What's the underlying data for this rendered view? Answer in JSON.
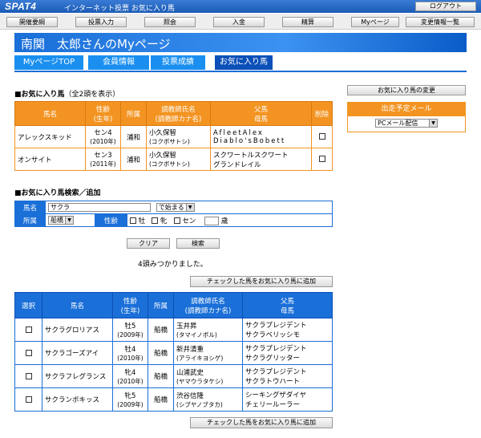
{
  "header": {
    "logo": "SPAT4",
    "subtitle": "インターネット投票 お気に入り馬",
    "logout": "ログアウト"
  },
  "nav": [
    "開催要綱",
    "投票入力",
    "照会",
    "入金",
    "精算",
    "Myページ",
    "変更情報一覧"
  ],
  "page_title": "南関　太郎さんのMyページ",
  "tabs": [
    "MyページTOP",
    "会員情報",
    "投票成績",
    "お気に入り馬"
  ],
  "favorites": {
    "heading": "■お気に入り馬",
    "count_note": "（全2頭を表示）",
    "headers": [
      "馬名",
      "性齢\n(生年)",
      "所属",
      "調教師氏名\n(調教師カナ名)",
      "父馬\n母馬",
      "削除"
    ],
    "rows": [
      {
        "name": "アレックスキッド",
        "age": "セン4",
        "year": "(2010年)",
        "affil": "浦和",
        "trainer": "小久保智",
        "trainer_kana": "(コクボサトシ)",
        "sire": "AfleetAlex",
        "dam": "Diablo'sBobett"
      },
      {
        "name": "オンサイト",
        "age": "セン3",
        "year": "(2011年)",
        "affil": "浦和",
        "trainer": "小久保智",
        "trainer_kana": "(コクボサトシ)",
        "sire": "スクワートルスクワート",
        "dam": "グランドレイル"
      }
    ]
  },
  "side": {
    "change_btn": "お気に入り馬の変更",
    "mail_title": "出走予定メール",
    "mail_select": "PCメール配信"
  },
  "search": {
    "heading": "■お気に入り馬検索／追加",
    "name_label": "馬名",
    "name_value": "サクラ",
    "match": "で始まる",
    "affil_label": "所属",
    "affil_value": "船橋",
    "age_label": "性齢",
    "sex": [
      "牡",
      "牝",
      "セン"
    ],
    "age_unit": "歳",
    "clear": "クリア",
    "search": "検索",
    "result_msg": "4頭みつかりました。",
    "add_btn": "チェックした馬をお気に入り馬に追加"
  },
  "results": {
    "headers": [
      "選択",
      "馬名",
      "性齢\n(生年)",
      "所属",
      "調教師氏名\n(調教師カナ名)",
      "父馬\n母馬"
    ],
    "rows": [
      {
        "name": "サクラグロリアス",
        "age": "牡5",
        "year": "(2009年)",
        "affil": "船橋",
        "trainer": "玉井昇",
        "trainer_kana": "(タマイノボル)",
        "sire": "サクラプレジデント",
        "dam": "サクラベリッシモ"
      },
      {
        "name": "サクラゴーズアイ",
        "age": "牡4",
        "year": "(2010年)",
        "affil": "船橋",
        "trainer": "新井清重",
        "trainer_kana": "(アライキヨシゲ)",
        "sire": "サクラプレジデント",
        "dam": "サクラグリッター"
      },
      {
        "name": "サクラフレグランス",
        "age": "牝4",
        "year": "(2010年)",
        "affil": "船橋",
        "trainer": "山浦武史",
        "trainer_kana": "(ヤマウラタケシ)",
        "sire": "サクラプレジデント",
        "dam": "サクラトウハート"
      },
      {
        "name": "サクランボキッス",
        "age": "牝5",
        "year": "(2009年)",
        "affil": "船橋",
        "trainer": "渋谷信隆",
        "trainer_kana": "(シブヤノブタカ)",
        "sire": "シーキングザダイヤ",
        "dam": "チェリールーラー"
      }
    ]
  }
}
